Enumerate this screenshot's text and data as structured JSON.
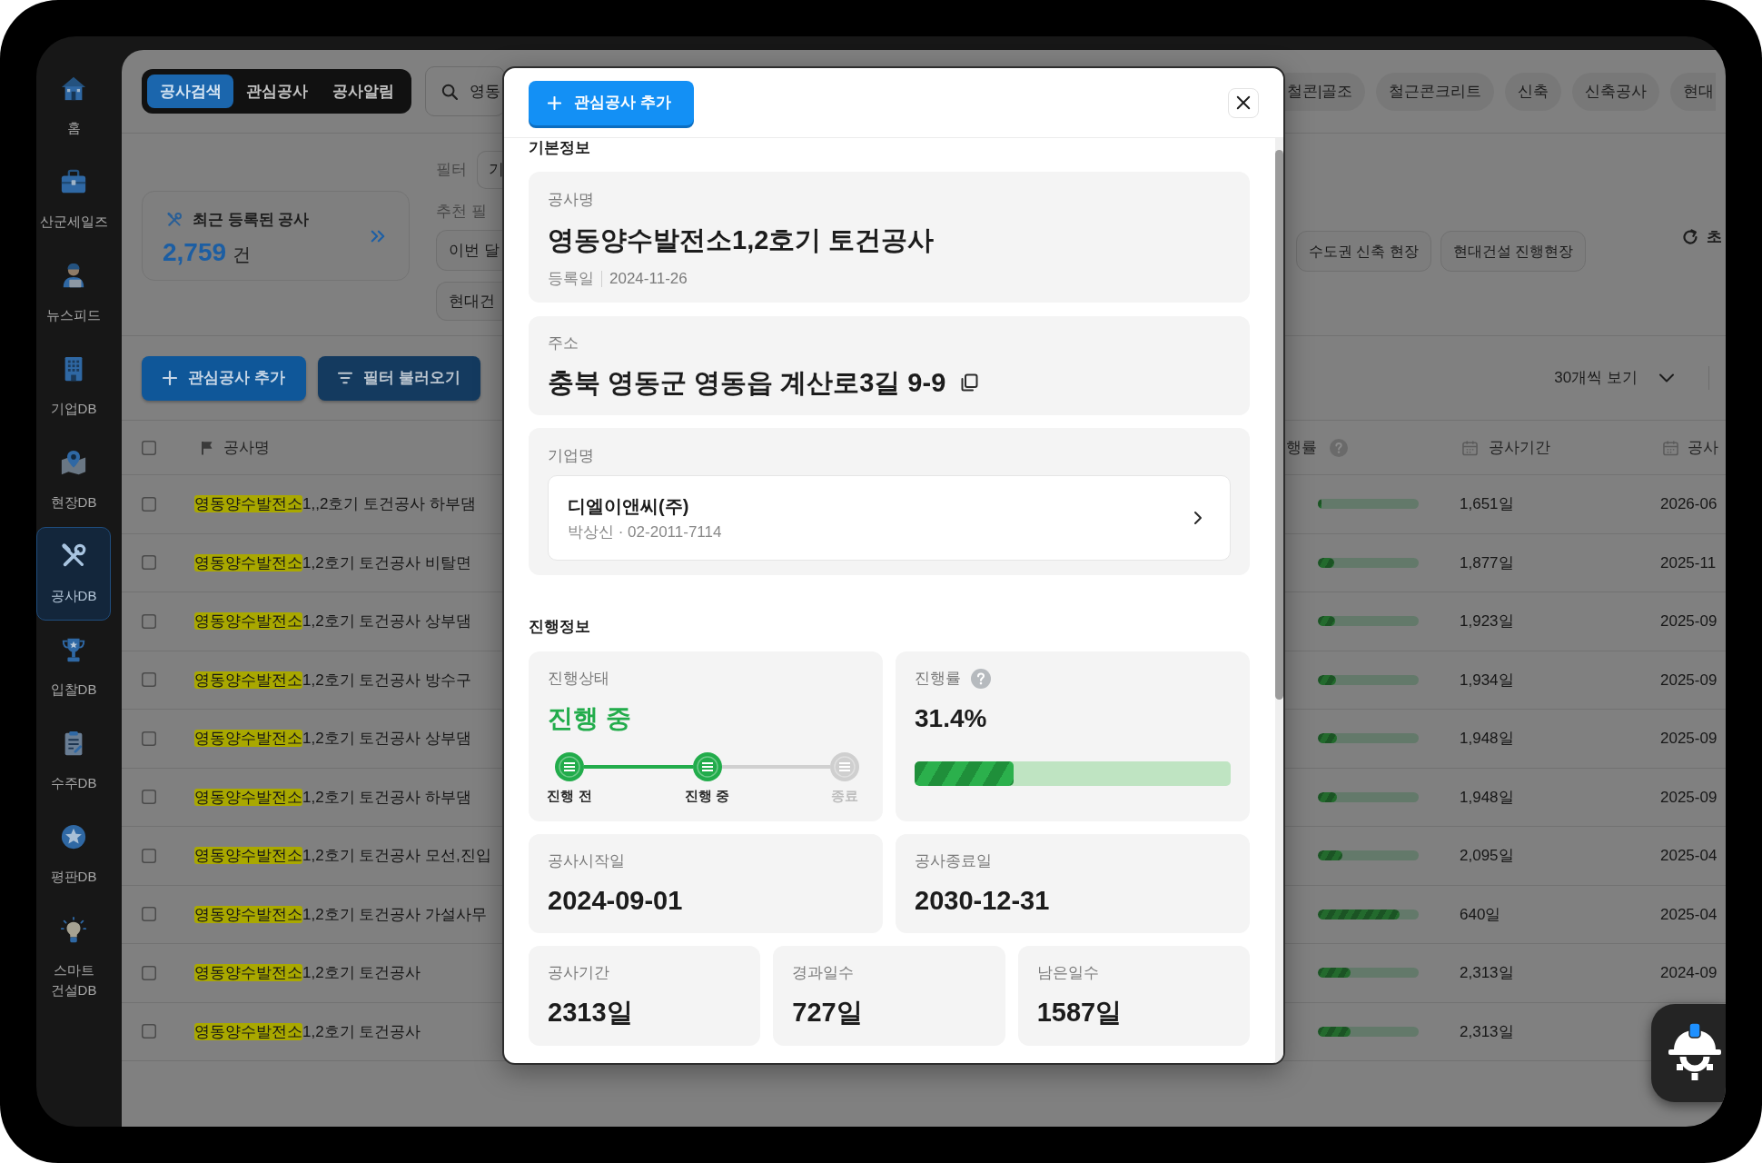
{
  "sidebar": {
    "items": [
      {
        "label": "홈",
        "selected": false
      },
      {
        "label": "산군세일즈",
        "selected": false
      },
      {
        "label": "뉴스피드",
        "selected": false
      },
      {
        "label": "기업DB",
        "selected": false
      },
      {
        "label": "현장DB",
        "selected": false
      },
      {
        "label": "공사DB",
        "selected": true
      },
      {
        "label": "입찰DB",
        "selected": false
      },
      {
        "label": "수주DB",
        "selected": false
      },
      {
        "label": "평판DB",
        "selected": false
      },
      {
        "label": "스마트 건설DB",
        "selected": false
      }
    ]
  },
  "top_bar": {
    "tabs": [
      {
        "label": "공사검색",
        "selected": true
      },
      {
        "label": "관심공사",
        "selected": false
      },
      {
        "label": "공사알림",
        "selected": false
      }
    ],
    "search": {
      "value": "영동"
    },
    "keyword_chips": [
      "철콘|골조",
      "철근콘크리트",
      "신축",
      "신축공사",
      "현대"
    ]
  },
  "summary_card": {
    "title": "최근 등록된 공사",
    "count": "2,759",
    "unit": "건"
  },
  "filters": {
    "label": "필터",
    "value": "기",
    "recommended_label": "추천 필",
    "recommended_chips": [
      "이번 달",
      "현대건"
    ],
    "preset_chips": [
      "수도권 신축 현장",
      "현대건설 진행현장"
    ],
    "reset": "초"
  },
  "toolbar": {
    "buttons": [
      {
        "kind": "add",
        "label": "관심공사 추가"
      },
      {
        "kind": "load",
        "label": "필터 불러오기"
      }
    ],
    "page_size": "30개씩 보기"
  },
  "table": {
    "select_all": {
      "checked": false
    },
    "columns": [
      {
        "label": "공사명"
      },
      {
        "label": "행률"
      },
      {
        "label": "공사기간"
      },
      {
        "label": "공사"
      }
    ],
    "rows": [
      {
        "checked": false,
        "match": "영동양수발전소",
        "rest": "1,,2호기 토건공사 하부댐",
        "level": 0.04,
        "duration": "1,651일",
        "column_4": "2026-06"
      },
      {
        "checked": false,
        "match": "영동양수발전소",
        "rest": "1,2호기 토건공사 비탈면",
        "level": 0.16,
        "duration": "1,877일",
        "column_4": "2025-11"
      },
      {
        "checked": false,
        "match": "영동양수발전소",
        "rest": "1,2호기 토건공사 상부댐",
        "level": 0.17,
        "duration": "1,923일",
        "column_4": "2025-09"
      },
      {
        "checked": false,
        "match": "영동양수발전소",
        "rest": "1,2호기 토건공사 방수구",
        "level": 0.18,
        "duration": "1,934일",
        "column_4": "2025-09"
      },
      {
        "checked": false,
        "match": "영동양수발전소",
        "rest": "1,2호기 토건공사 상부댐",
        "level": 0.19,
        "duration": "1,948일",
        "column_4": "2025-09"
      },
      {
        "checked": false,
        "match": "영동양수발전소",
        "rest": "1,2호기 토건공사 하부댐",
        "level": 0.19,
        "duration": "1,948일",
        "column_4": "2025-09"
      },
      {
        "checked": false,
        "match": "영동양수발전소",
        "rest": "1,2호기 토건공사 모선,진입",
        "level": 0.24,
        "duration": "2,095일",
        "column_4": "2025-04"
      },
      {
        "checked": false,
        "match": "영동양수발전소",
        "rest": "1,2호기 토건공사 가설사무",
        "level": 0.81,
        "duration": "640일",
        "column_4": "2025-04"
      },
      {
        "checked": false,
        "match": "영동양수발전소",
        "rest": "1,2호기 토건공사",
        "level": 0.32,
        "duration": "2,313일",
        "column_4": "2024-09"
      },
      {
        "checked": false,
        "match": "영동양수발전소",
        "rest": "1,2호기 토건공사",
        "level": 0.32,
        "duration": "2,313일"
      }
    ]
  },
  "modal": {
    "add_button": "관심공사 추가",
    "basic_info": {
      "title": "기본정보",
      "project": {
        "label": "공사명",
        "value": "영동양수발전소1,2호기 토건공사",
        "date_label": "등록일",
        "date": "2024-11-26"
      },
      "address": {
        "label": "주소",
        "value": "충북 영동군 영동읍 계산로3길 9-9"
      },
      "company": {
        "label": "기업명",
        "name": "디엘이앤씨(주)",
        "contact": "박상신 · 02-2011-7114"
      }
    },
    "progress_info": {
      "title": "진행정보",
      "status": {
        "label": "진행상태",
        "value": "진행 중",
        "steps": [
          {
            "label": "진행 전",
            "reached": true
          },
          {
            "label": "진행 중",
            "reached": true
          },
          {
            "label": "종료",
            "reached": false
          }
        ]
      },
      "rate": {
        "label": "진행률",
        "value": "31.4%",
        "level": 0.314
      },
      "dates": [
        {
          "label": "공사시작일",
          "value": "2024-09-01"
        },
        {
          "label": "공사종료일",
          "value": "2030-12-31"
        }
      ],
      "counts": [
        {
          "label": "공사기간",
          "value": "2313일"
        },
        {
          "label": "경과일수",
          "value": "727일"
        },
        {
          "label": "남은일수",
          "value": "1587일"
        }
      ]
    }
  }
}
